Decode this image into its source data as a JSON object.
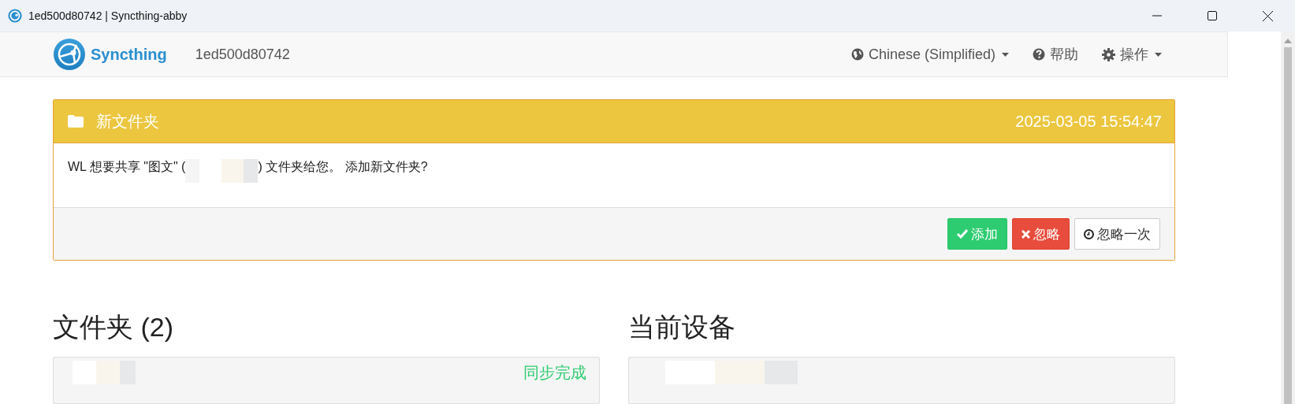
{
  "window": {
    "title": "1ed500d80742 | Syncthing-abby"
  },
  "navbar": {
    "brand": "Syncthing",
    "device_id": "1ed500d80742",
    "items": [
      {
        "kind": "language",
        "label": "Chinese (Simplified)",
        "dropdown": true
      },
      {
        "kind": "help",
        "label": "帮助",
        "dropdown": false
      },
      {
        "kind": "actions",
        "label": "操作",
        "dropdown": true
      }
    ]
  },
  "notice": {
    "title": "新文件夹",
    "time": "2025-03-05 15:54:47",
    "message_start": "WL 想要共享 \"图文\" (",
    "message_end": ") 文件夹给您。 添加新文件夹?",
    "buttons": [
      {
        "kind": "add",
        "label": "添加"
      },
      {
        "kind": "ignore",
        "label": "忽略"
      },
      {
        "kind": "later",
        "label": "忽略一次"
      }
    ]
  },
  "folders": {
    "heading": "文件夹 (2)",
    "items": [
      {
        "status": "同步完成"
      }
    ]
  },
  "this_device": {
    "heading": "当前设备"
  }
}
